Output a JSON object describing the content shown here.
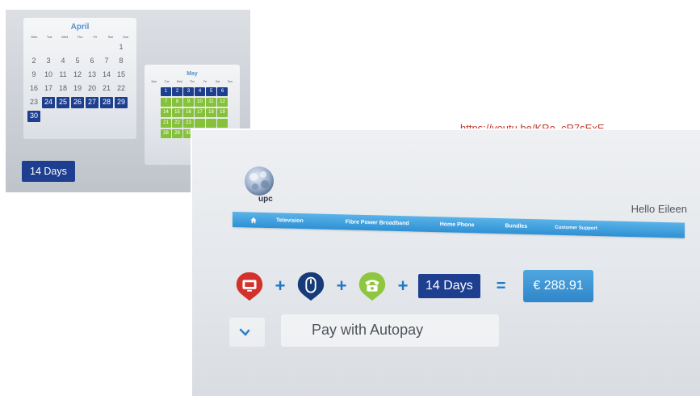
{
  "calendar_april": {
    "month": "April",
    "weekdays": [
      "Mon",
      "Tue",
      "Wed",
      "Thu",
      "Fri",
      "Sat",
      "Sun"
    ],
    "days": [
      {
        "d": "",
        "s": false
      },
      {
        "d": "",
        "s": false
      },
      {
        "d": "",
        "s": false
      },
      {
        "d": "",
        "s": false
      },
      {
        "d": "",
        "s": false
      },
      {
        "d": "",
        "s": false
      },
      {
        "d": "1",
        "s": false
      },
      {
        "d": "2",
        "s": false
      },
      {
        "d": "3",
        "s": false
      },
      {
        "d": "4",
        "s": false
      },
      {
        "d": "5",
        "s": false
      },
      {
        "d": "6",
        "s": false
      },
      {
        "d": "7",
        "s": false
      },
      {
        "d": "8",
        "s": false
      },
      {
        "d": "9",
        "s": false
      },
      {
        "d": "10",
        "s": false
      },
      {
        "d": "11",
        "s": false
      },
      {
        "d": "12",
        "s": false
      },
      {
        "d": "13",
        "s": false
      },
      {
        "d": "14",
        "s": false
      },
      {
        "d": "15",
        "s": false
      },
      {
        "d": "16",
        "s": false
      },
      {
        "d": "17",
        "s": false
      },
      {
        "d": "18",
        "s": false
      },
      {
        "d": "19",
        "s": false
      },
      {
        "d": "20",
        "s": false
      },
      {
        "d": "21",
        "s": false
      },
      {
        "d": "22",
        "s": false
      },
      {
        "d": "23",
        "s": false
      },
      {
        "d": "24",
        "s": true
      },
      {
        "d": "25",
        "s": true
      },
      {
        "d": "26",
        "s": true
      },
      {
        "d": "27",
        "s": true
      },
      {
        "d": "28",
        "s": true
      },
      {
        "d": "29",
        "s": true
      },
      {
        "d": "30",
        "s": true
      }
    ],
    "selected_color": "#1e3f8f"
  },
  "calendar_may": {
    "month": "May",
    "weekdays": [
      "Mon",
      "Tue",
      "Wed",
      "Thu",
      "Fri",
      "Sat",
      "Sun"
    ],
    "days": [
      {
        "d": "1",
        "c": "blue"
      },
      {
        "d": "2",
        "c": "blue"
      },
      {
        "d": "3",
        "c": "blue"
      },
      {
        "d": "4",
        "c": "blue"
      },
      {
        "d": "5",
        "c": "blue"
      },
      {
        "d": "6",
        "c": "blue"
      },
      {
        "d": "7",
        "c": "green"
      },
      {
        "d": "8",
        "c": "green"
      },
      {
        "d": "9",
        "c": "green"
      },
      {
        "d": "10",
        "c": "green"
      },
      {
        "d": "11",
        "c": "green"
      },
      {
        "d": "12",
        "c": "green"
      },
      {
        "d": "14",
        "c": "green"
      },
      {
        "d": "15",
        "c": "green"
      },
      {
        "d": "16",
        "c": "green"
      },
      {
        "d": "17",
        "c": "green"
      },
      {
        "d": "18",
        "c": "green"
      },
      {
        "d": "19",
        "c": "green"
      },
      {
        "d": "21",
        "c": "green"
      },
      {
        "d": "22",
        "c": "green"
      },
      {
        "d": "23",
        "c": "green"
      },
      {
        "d": "",
        "c": "green"
      },
      {
        "d": "",
        "c": "green"
      },
      {
        "d": "",
        "c": "green"
      },
      {
        "d": "28",
        "c": "green"
      },
      {
        "d": "29",
        "c": "green"
      },
      {
        "d": "30",
        "c": "green"
      }
    ],
    "accent_blue": "#1e3f8f",
    "accent_green": "#86c13a"
  },
  "days_badge_small": "14 Days",
  "video_link": "https://youtu.be/KRo_cR7sExE",
  "upc": {
    "logo_text": "upc",
    "greeting": "Hello Eileen",
    "nav": {
      "home_icon": "home-icon",
      "items": [
        "Television",
        "Fibre Power Broadband",
        "Home Phone",
        "Bundles",
        "Customer Support"
      ]
    },
    "bundle": {
      "services": [
        "tv-icon",
        "broadband-mouse-icon",
        "phone-icon"
      ],
      "plus": "+",
      "days_label": "14 Days",
      "equals": "=",
      "price": "€ 288.91"
    },
    "autopay_label": "Pay with Autopay",
    "nav_color": "#2e90d4"
  }
}
